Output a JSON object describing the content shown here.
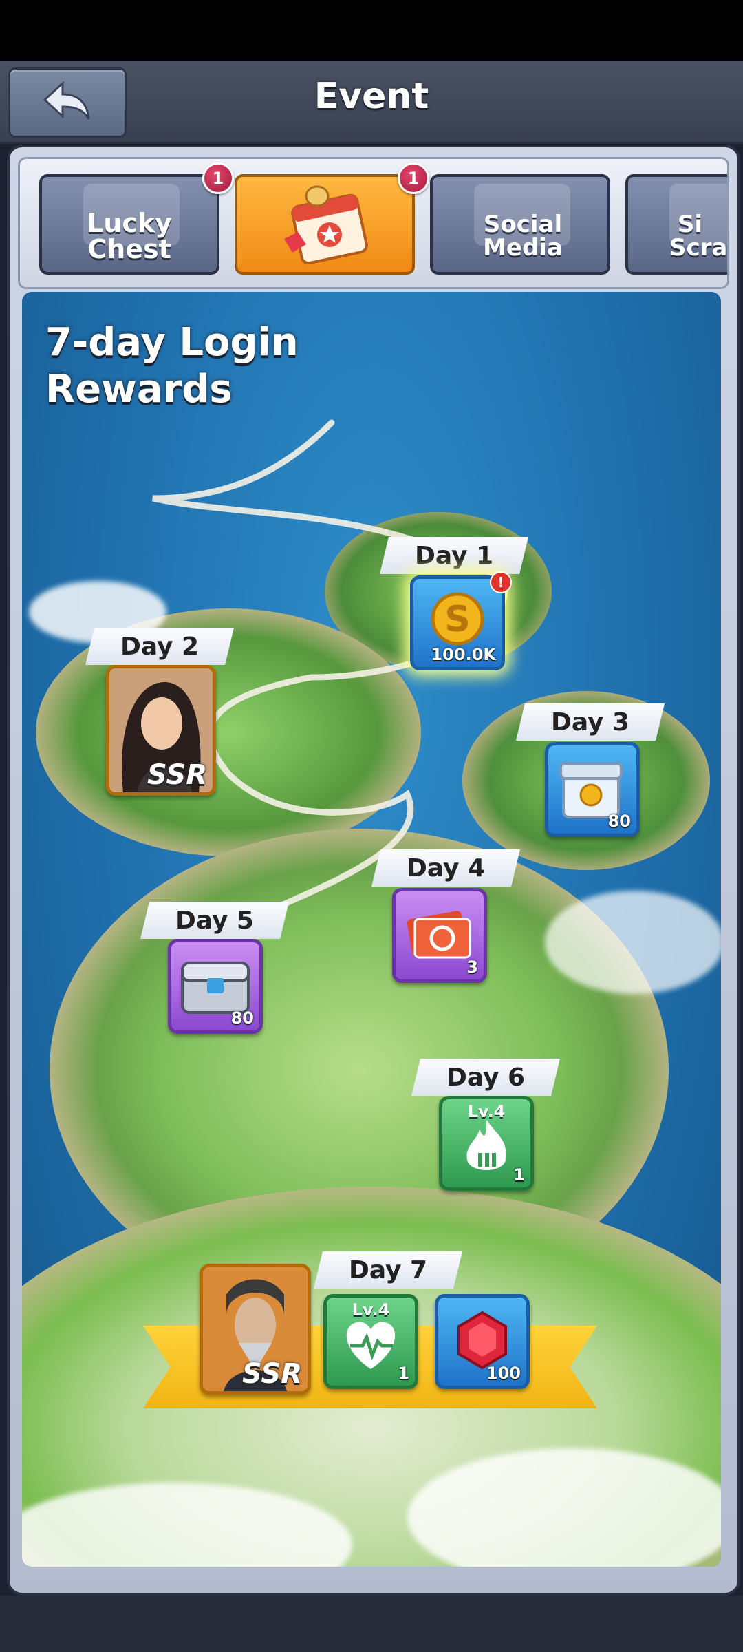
{
  "header": {
    "title": "Event"
  },
  "tabs": [
    {
      "label": "Lucky Chest",
      "badge": "1",
      "active": false
    },
    {
      "label": "",
      "badge": "1",
      "active": true
    },
    {
      "label": "Social Media",
      "badge": "",
      "active": false
    },
    {
      "label": "Si Scra",
      "badge": "",
      "active": false
    }
  ],
  "event": {
    "title_line1": "7-day Login",
    "title_line2": "Rewards",
    "days": [
      {
        "label": "Day 1",
        "reward": "coin",
        "qty": "100.0K",
        "alert": "!"
      },
      {
        "label": "Day 2",
        "reward": "ssr-hero",
        "rarity": "SSR"
      },
      {
        "label": "Day 3",
        "reward": "coin-box",
        "qty": "80"
      },
      {
        "label": "Day 4",
        "reward": "recruit-tickets",
        "qty": "3"
      },
      {
        "label": "Day 5",
        "reward": "metal-chest",
        "qty": "80"
      },
      {
        "label": "Day 6",
        "reward": "fire-skill-book",
        "level": "Lv.4",
        "qty": "1"
      },
      {
        "label": "Day 7",
        "rewards": [
          {
            "reward": "ssr-hero",
            "rarity": "SSR"
          },
          {
            "reward": "heal-skill-book",
            "level": "Lv.4",
            "qty": "1"
          },
          {
            "reward": "ruby-gem",
            "qty": "100"
          }
        ]
      }
    ]
  },
  "colors": {
    "active_tab": "#f5a020",
    "tab": "#6c789a",
    "sea": "#1f6fac",
    "ribbon": "#f5c21c"
  },
  "icons": [
    "back-arrow-icon",
    "coin-icon",
    "gem-icon"
  ]
}
